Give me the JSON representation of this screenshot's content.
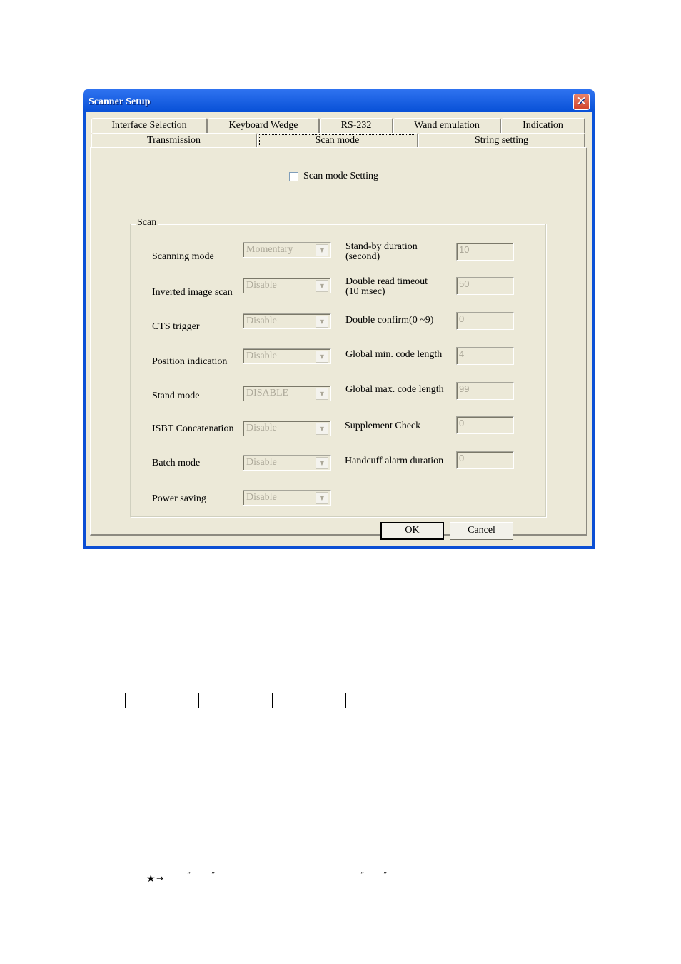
{
  "window": {
    "title": "Scanner Setup",
    "close_icon": "close-icon"
  },
  "tabs": {
    "row1": [
      {
        "label": "Interface Selection"
      },
      {
        "label": "Keyboard Wedge"
      },
      {
        "label": "RS-232"
      },
      {
        "label": "Wand emulation"
      },
      {
        "label": "Indication"
      }
    ],
    "row2": [
      {
        "label": "Transmission"
      },
      {
        "label": "Scan mode",
        "active": true
      },
      {
        "label": "String setting"
      }
    ]
  },
  "settings_checkbox": {
    "label": "Scan mode Setting",
    "checked": false
  },
  "group": {
    "title": "Scan",
    "left_fields": [
      {
        "label": "Scanning mode",
        "value": "Momentary"
      },
      {
        "label": "Inverted image scan",
        "value": "Disable"
      },
      {
        "label": "CTS trigger",
        "value": "Disable"
      },
      {
        "label": "Position indication",
        "value": "Disable"
      },
      {
        "label": "Stand mode",
        "value": "DISABLE"
      },
      {
        "label": "ISBT Concatenation",
        "value": "Disable"
      },
      {
        "label": "Batch mode",
        "value": "Disable"
      },
      {
        "label": "Power saving",
        "value": "Disable"
      }
    ],
    "right_fields": [
      {
        "label_line1": "Stand-by duration",
        "label_line2": "(second)",
        "value": "10"
      },
      {
        "label_line1": "Double read timeout",
        "label_line2": "(10 msec)",
        "value": "50"
      },
      {
        "label_line1": "Double confirm(0 ~9)",
        "value": "0"
      },
      {
        "label_line1": "Global min. code length",
        "value": "4"
      },
      {
        "label_line1": "Global max. code length",
        "value": "99"
      },
      {
        "label_line1": "Supplement Check",
        "value": "0"
      },
      {
        "label_line1": "Handcuff alarm duration",
        "value": "0"
      }
    ]
  },
  "buttons": {
    "ok": "OK",
    "cancel": "Cancel"
  },
  "document": {
    "table_cells": [
      "",
      "",
      ""
    ],
    "footnote": {
      "star": "★",
      "arrow": "→",
      "quote_open": "“",
      "quote_close": "”"
    }
  }
}
